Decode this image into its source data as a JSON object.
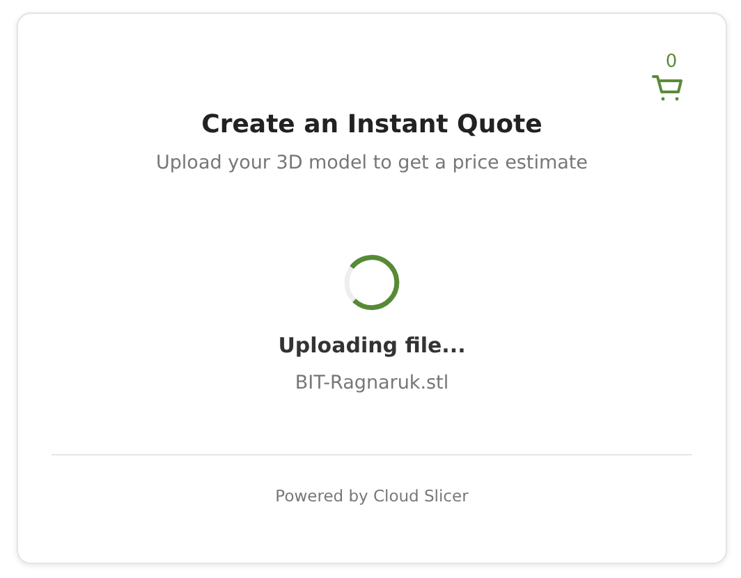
{
  "cart": {
    "count": "0"
  },
  "header": {
    "title": "Create an Instant Quote",
    "subtitle": "Upload your 3D model to get a price estimate"
  },
  "upload": {
    "status": "Uploading file...",
    "filename": "BIT-Ragnaruk.stl"
  },
  "footer": {
    "text": "Powered by Cloud Slicer"
  }
}
